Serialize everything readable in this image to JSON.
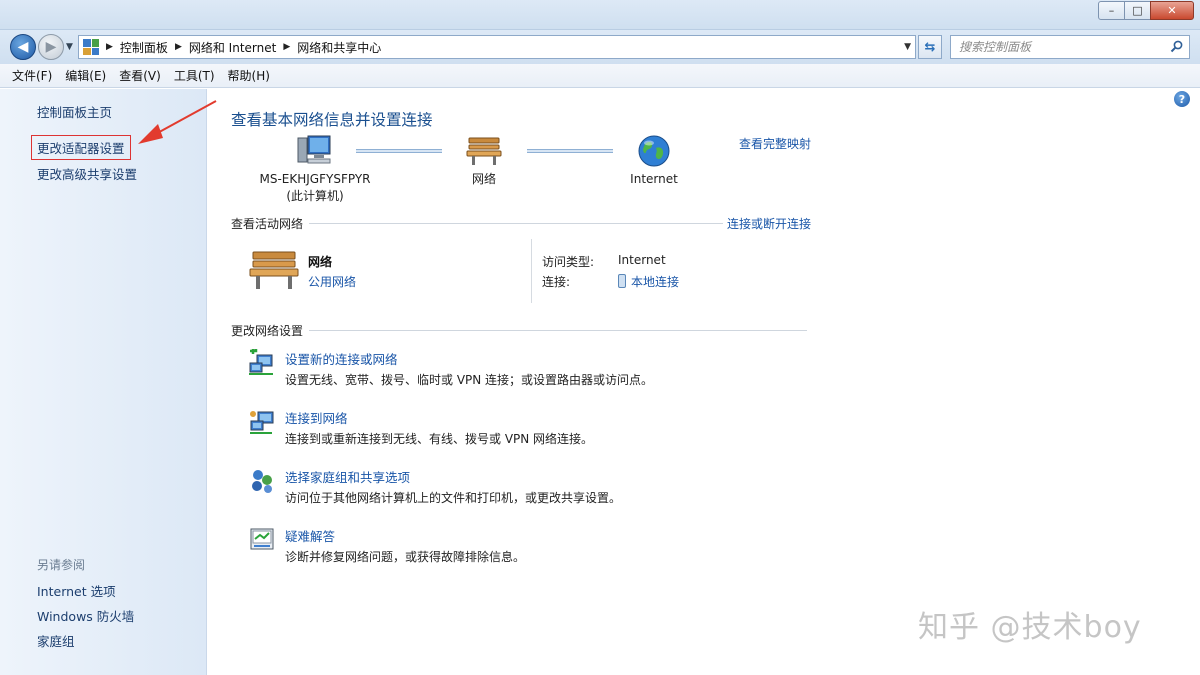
{
  "window": {
    "minimize_glyph": "–",
    "maximize_glyph": "□",
    "close_glyph": "✕"
  },
  "address": {
    "breadcrumbs": [
      "控制面板",
      "网络和 Internet",
      "网络和共享中心"
    ],
    "search_placeholder": "搜索控制面板"
  },
  "menu": [
    "文件(F)",
    "编辑(E)",
    "查看(V)",
    "工具(T)",
    "帮助(H)"
  ],
  "sidebar": {
    "links": [
      "控制面板主页",
      "更改适配器设置",
      "更改高级共享设置"
    ],
    "see_also_title": "另请参阅",
    "see_also": [
      "Internet 选项",
      "Windows 防火墙",
      "家庭组"
    ]
  },
  "main": {
    "title": "查看基本网络信息并设置连接",
    "view_full_map": "查看完整映射",
    "nodes": [
      {
        "label": "MS-EKHJGFYSFPYR",
        "sub": "(此计算机)"
      },
      {
        "label": "网络",
        "sub": ""
      },
      {
        "label": "Internet",
        "sub": ""
      }
    ],
    "active_section": {
      "title": "查看活动网络",
      "link": "连接或断开连接",
      "network_name": "网络",
      "network_type": "公用网络",
      "access_type_label": "访问类型:",
      "access_type_value": "Internet",
      "connection_label": "连接:",
      "connection_value": "本地连接"
    },
    "change_section": {
      "title": "更改网络设置",
      "tasks": [
        {
          "link": "设置新的连接或网络",
          "desc": "设置无线、宽带、拨号、临时或 VPN 连接；或设置路由器或访问点。"
        },
        {
          "link": "连接到网络",
          "desc": "连接到或重新连接到无线、有线、拨号或 VPN 网络连接。"
        },
        {
          "link": "选择家庭组和共享选项",
          "desc": "访问位于其他网络计算机上的文件和打印机，或更改共享设置。"
        },
        {
          "link": "疑难解答",
          "desc": "诊断并修复网络问题，或获得故障排除信息。"
        }
      ]
    }
  },
  "watermark": "知乎 @技术boy",
  "colors": {
    "link": "#1a56a8",
    "title": "#1a4f8f",
    "highlight": "#dd3333"
  },
  "icons": [
    "back-arrow-icon",
    "forward-arrow-icon",
    "control-panel-icon",
    "refresh-icon",
    "search-icon",
    "help-icon",
    "computer-icon",
    "bench-icon",
    "globe-icon",
    "plug-icon",
    "new-connection-icon",
    "connect-network-icon",
    "homegroup-icon",
    "troubleshoot-icon"
  ]
}
